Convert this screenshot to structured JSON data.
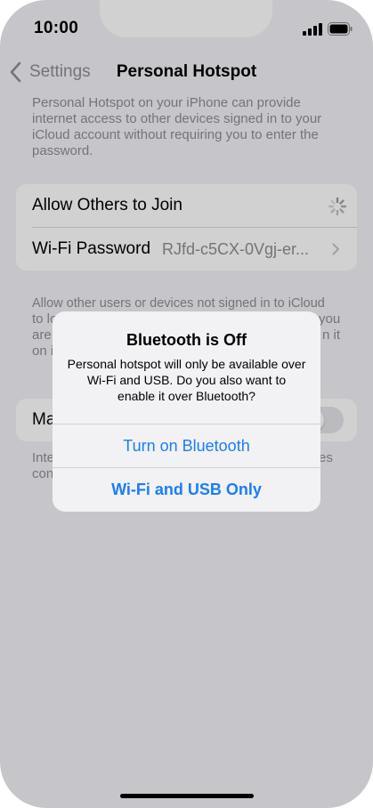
{
  "status_bar": {
    "time": "10:00"
  },
  "nav": {
    "back_label": "Settings",
    "title": "Personal Hotspot"
  },
  "intro_text": "Personal Hotspot on your iPhone can provide internet access to other devices signed in to your iCloud account without requiring you to enter the password.",
  "settings_group": {
    "allow_others_label": "Allow Others to Join",
    "wifi_password_label": "Wi-Fi Password",
    "wifi_password_value": "RJfd-c5CX-0Vgj-er..."
  },
  "background_text": {
    "allow_desc_line1": "Allow other users or devices not signed in to iCloud",
    "allow_desc_fragments": [
      "to lo",
      "you",
      "are",
      "n it",
      "on i"
    ],
    "maximize_label_fragment": "Ma",
    "maximize_desc_fragments": [
      "Inte",
      "es",
      "con"
    ]
  },
  "alert": {
    "title": "Bluetooth is Off",
    "message": "Personal hotspot will only be available over Wi-Fi and USB. Do you also want to enable it over Bluetooth?",
    "primary_button": "Turn on Bluetooth",
    "secondary_button": "Wi-Fi and USB Only"
  },
  "colors": {
    "accent": "#1b7ef5",
    "secondary_text": "#8e8e93",
    "background": "#f2f2f7"
  },
  "icons": {
    "back": "chevron-left-icon",
    "disclosure": "chevron-right-icon",
    "loading": "activity-spinner-icon",
    "signal": "cellular-signal-icon",
    "battery": "battery-icon"
  }
}
